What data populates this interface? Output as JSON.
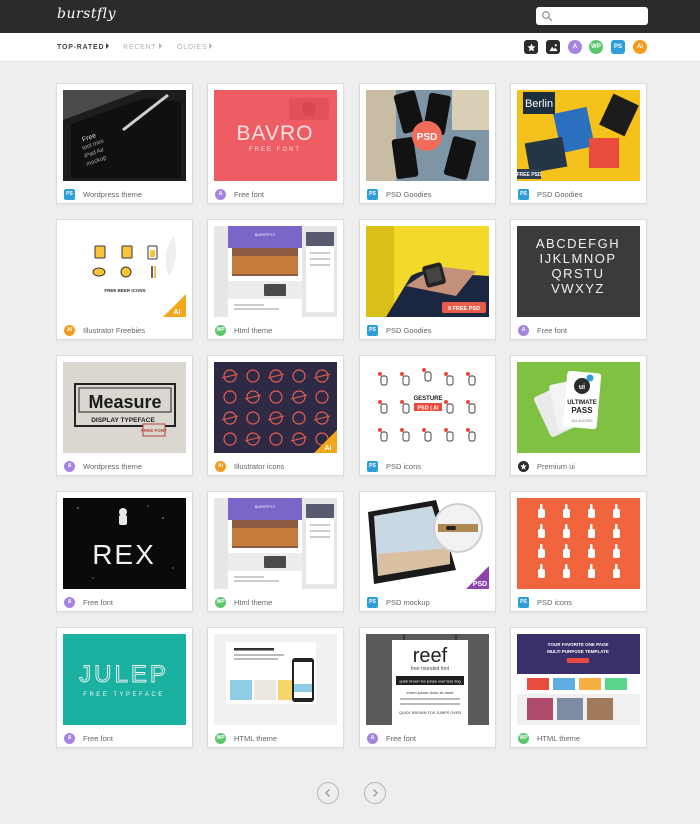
{
  "brand": {
    "logo": "burstfly"
  },
  "search": {
    "placeholder": ""
  },
  "filters": {
    "tabs": [
      {
        "label": "TOP-RATED",
        "active": true
      },
      {
        "label": "RECENT",
        "active": false
      },
      {
        "label": "OLDIES",
        "active": false
      }
    ],
    "categories": [
      {
        "name": "premium-icon",
        "label": "★",
        "color": "#2b2b2b"
      },
      {
        "name": "image-icon",
        "label": "▲",
        "color": "#2b2b2b"
      },
      {
        "name": "font",
        "label": "A",
        "color": "#a685e2"
      },
      {
        "name": "wordpress",
        "label": "WP",
        "color": "#5cc66e"
      },
      {
        "name": "photoshop",
        "label": "PS",
        "color": "#2d9fd9"
      },
      {
        "name": "illustrator",
        "label": "Ai",
        "color": "#f39c1f"
      }
    ]
  },
  "badge_colors": {
    "PS": "#2d9fd9",
    "A": "#a685e2",
    "WP": "#5cc66e",
    "Ai": "#f39c1f",
    "★": "#2b2b2b"
  },
  "cards": [
    {
      "badge": "PS",
      "caption": "Wordpress theme",
      "thumb": "tablet-pen"
    },
    {
      "badge": "A",
      "caption": "Free font",
      "thumb": "bavro",
      "title": "BAVRO",
      "subtitle": "FREE FONT"
    },
    {
      "badge": "PS",
      "caption": "PSD Goodies",
      "thumb": "phones-psd",
      "tag": "PSD"
    },
    {
      "badge": "PS",
      "caption": "PSD Goodies",
      "thumb": "berlin",
      "title": "Berlin",
      "tag": "FREE PSD"
    },
    {
      "badge": "Ai",
      "caption": "Illustrator Freebies",
      "thumb": "beer-icons",
      "title": "FREE BEER ICONS",
      "corner": "AI"
    },
    {
      "badge": "WP",
      "caption": "Html theme",
      "thumb": "html-purple"
    },
    {
      "badge": "PS",
      "caption": "PSD Goodies",
      "thumb": "watch-wrist",
      "tag": "9 FREE PSD"
    },
    {
      "badge": "A",
      "caption": "Free font",
      "thumb": "alphabet",
      "lines": [
        "ABCDEFGH",
        "IJKLMNOP",
        "QRSTU",
        "VWXYZ"
      ]
    },
    {
      "badge": "A",
      "caption": "Wordpress theme",
      "thumb": "measure",
      "title": "Measure",
      "subtitle": "DISPLAY TYPEFACE",
      "tag": "FREE FONT"
    },
    {
      "badge": "Ai",
      "caption": "Illustrator icons",
      "thumb": "space-icons",
      "corner": "AI"
    },
    {
      "badge": "PS",
      "caption": "PSD icons",
      "thumb": "gestures",
      "title": "GESTURE",
      "subtitle": "PSD | AI"
    },
    {
      "badge": "★",
      "caption": "Premium ui",
      "thumb": "ultimate-pass",
      "title": "ULTIMATE PASS",
      "subtitle": "ALL ACCESS"
    },
    {
      "badge": "A",
      "caption": "Free font",
      "thumb": "rex",
      "title": "REX"
    },
    {
      "badge": "WP",
      "caption": "Html theme",
      "thumb": "html-purple"
    },
    {
      "badge": "PS",
      "caption": "PSD mockup",
      "thumb": "laptop",
      "corner": "PSD"
    },
    {
      "badge": "PS",
      "caption": "PSD icons",
      "thumb": "hand-icons"
    },
    {
      "badge": "A",
      "caption": "Free font",
      "thumb": "julep",
      "title": "JULEP",
      "subtitle": "FREE TYPEFACE"
    },
    {
      "badge": "WP",
      "caption": "HTML theme",
      "thumb": "white-site"
    },
    {
      "badge": "A",
      "caption": "Free font",
      "thumb": "reef",
      "title": "reef",
      "subtitle": "free rounded font",
      "lines": [
        "quick brown fox jumps over lazy dog",
        "lorem ipsum dolor sit amet",
        "QUICK BROWN FOX JUMPS OVER"
      ]
    },
    {
      "badge": "WP",
      "caption": "HTML theme",
      "thumb": "onepage",
      "title": "YOUR FAVORITE ONE PAGE",
      "subtitle": "MULTI PURPOSE TEMPLATE"
    }
  ],
  "pagination": {
    "prev_label": "previous page",
    "next_label": "next page"
  }
}
